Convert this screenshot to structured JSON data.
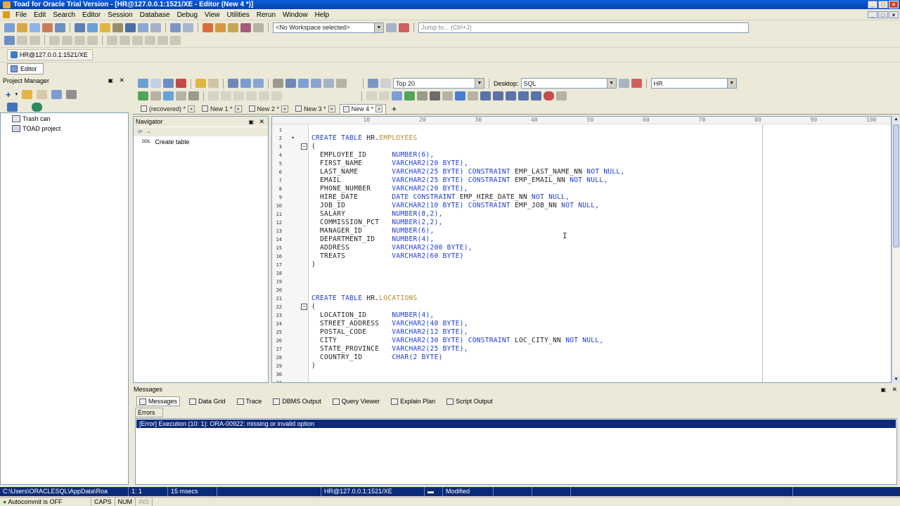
{
  "window": {
    "title": "Toad for Oracle Trial Version - [HR@127.0.0.1:1521/XE - Editor (New 4 *)]"
  },
  "menu": [
    "File",
    "Edit",
    "Search",
    "Editor",
    "Session",
    "Database",
    "Debug",
    "View",
    "Utilities",
    "Rerun",
    "Window",
    "Help"
  ],
  "toolbar": {
    "workspace": "<No Workspace selected>",
    "jump_to": "Jump to... (Ctrl+J)"
  },
  "connection": {
    "tab": "HR@127.0.0.1:1521/XE"
  },
  "editor_window": {
    "tab": "Editor"
  },
  "project_manager": {
    "title": "Project Manager",
    "items": [
      "Trash can",
      "TOAD project"
    ]
  },
  "editor_toolbar": {
    "top_n": "Top 20",
    "desktop_label": "Desktop:",
    "desktop_value": "SQL",
    "schema": "HR"
  },
  "doc_tabs": [
    {
      "label": "(recovered) *",
      "active": false
    },
    {
      "label": "New 1 *",
      "active": false
    },
    {
      "label": "New 2 *",
      "active": false
    },
    {
      "label": "New 3 *",
      "active": false
    },
    {
      "label": "New 4 *",
      "active": true
    }
  ],
  "navigator": {
    "title": "Navigator",
    "item_tag": "DDL",
    "item": "Create table"
  },
  "ruler": [
    "10",
    "20",
    "30",
    "40",
    "50",
    "60",
    "70",
    "80",
    "90",
    "100"
  ],
  "code_lines": [
    {
      "n": "1",
      "parts": []
    },
    {
      "n": "2",
      "parts": [
        {
          "c": "kw",
          "t": "CREATE TABLE "
        },
        {
          "c": "tx",
          "t": "HR."
        },
        {
          "c": "nm",
          "t": "EMPLOYEES"
        }
      ]
    },
    {
      "n": "3",
      "parts": [
        {
          "c": "tx",
          "t": "("
        }
      ]
    },
    {
      "n": "4",
      "parts": [
        {
          "c": "tx",
          "t": "  EMPLOYEE_ID      "
        },
        {
          "c": "ty",
          "t": "NUMBER(6),"
        }
      ]
    },
    {
      "n": "5",
      "parts": [
        {
          "c": "tx",
          "t": "  FIRST_NAME       "
        },
        {
          "c": "ty",
          "t": "VARCHAR2(20 BYTE),"
        }
      ]
    },
    {
      "n": "6",
      "parts": [
        {
          "c": "tx",
          "t": "  LAST_NAME        "
        },
        {
          "c": "ty",
          "t": "VARCHAR2(25 BYTE) CONSTRAINT "
        },
        {
          "c": "tx",
          "t": "EMP_LAST_NAME_NN "
        },
        {
          "c": "kw",
          "t": "NOT NULL,"
        }
      ]
    },
    {
      "n": "7",
      "parts": [
        {
          "c": "tx",
          "t": "  EMAIL            "
        },
        {
          "c": "ty",
          "t": "VARCHAR2(25 BYTE) CONSTRAINT "
        },
        {
          "c": "tx",
          "t": "EMP_EMAIL_NN "
        },
        {
          "c": "kw",
          "t": "NOT NULL,"
        }
      ]
    },
    {
      "n": "8",
      "parts": [
        {
          "c": "tx",
          "t": "  PHONE_NUMBER     "
        },
        {
          "c": "ty",
          "t": "VARCHAR2(20 BYTE),"
        }
      ]
    },
    {
      "n": "9",
      "parts": [
        {
          "c": "tx",
          "t": "  HIRE_DATE        "
        },
        {
          "c": "ty",
          "t": "DATE CONSTRAINT "
        },
        {
          "c": "tx",
          "t": "EMP_HIRE_DATE_NN "
        },
        {
          "c": "kw",
          "t": "NOT NULL,"
        }
      ]
    },
    {
      "n": "10",
      "parts": [
        {
          "c": "tx",
          "t": "  JOB_ID           "
        },
        {
          "c": "ty",
          "t": "VARCHAR2(10 BYTE) CONSTRAINT "
        },
        {
          "c": "tx",
          "t": "EMP_JOB_NN "
        },
        {
          "c": "kw",
          "t": "NOT NULL,"
        }
      ]
    },
    {
      "n": "11",
      "parts": [
        {
          "c": "tx",
          "t": "  SALARY           "
        },
        {
          "c": "ty",
          "t": "NUMBER(8,2),"
        }
      ]
    },
    {
      "n": "12",
      "parts": [
        {
          "c": "tx",
          "t": "  COMMISSION_PCT   "
        },
        {
          "c": "ty",
          "t": "NUMBER(2,2),"
        }
      ]
    },
    {
      "n": "13",
      "parts": [
        {
          "c": "tx",
          "t": "  MANAGER_ID       "
        },
        {
          "c": "ty",
          "t": "NUMBER(6),"
        }
      ]
    },
    {
      "n": "14",
      "parts": [
        {
          "c": "tx",
          "t": "  DEPARTMENT_ID    "
        },
        {
          "c": "ty",
          "t": "NUMBER(4),"
        }
      ]
    },
    {
      "n": "15",
      "parts": [
        {
          "c": "tx",
          "t": "  ADDRESS          "
        },
        {
          "c": "ty",
          "t": "VARCHAR2(200 BYTE),"
        }
      ]
    },
    {
      "n": "16",
      "parts": [
        {
          "c": "tx",
          "t": "  TREATS           "
        },
        {
          "c": "ty",
          "t": "VARCHAR2(60 BYTE)"
        }
      ]
    },
    {
      "n": "17",
      "parts": [
        {
          "c": "tx",
          "t": ")"
        }
      ]
    },
    {
      "n": "18",
      "parts": []
    },
    {
      "n": "19",
      "parts": []
    },
    {
      "n": "20",
      "parts": []
    },
    {
      "n": "21",
      "parts": [
        {
          "c": "kw",
          "t": "CREATE TABLE "
        },
        {
          "c": "tx",
          "t": "HR."
        },
        {
          "c": "nm",
          "t": "LOCATIONS"
        }
      ]
    },
    {
      "n": "22",
      "parts": [
        {
          "c": "tx",
          "t": "("
        }
      ]
    },
    {
      "n": "23",
      "parts": [
        {
          "c": "tx",
          "t": "  LOCATION_ID      "
        },
        {
          "c": "ty",
          "t": "NUMBER(4),"
        }
      ]
    },
    {
      "n": "24",
      "parts": [
        {
          "c": "tx",
          "t": "  STREET_ADDRESS   "
        },
        {
          "c": "ty",
          "t": "VARCHAR2(40 BYTE),"
        }
      ]
    },
    {
      "n": "25",
      "parts": [
        {
          "c": "tx",
          "t": "  POSTAL_CODE      "
        },
        {
          "c": "ty",
          "t": "VARCHAR2(12 BYTE),"
        }
      ]
    },
    {
      "n": "26",
      "parts": [
        {
          "c": "tx",
          "t": "  CITY             "
        },
        {
          "c": "ty",
          "t": "VARCHAR2(30 BYTE) CONSTRAINT "
        },
        {
          "c": "tx",
          "t": "LOC_CITY_NN "
        },
        {
          "c": "kw",
          "t": "NOT NULL,"
        }
      ]
    },
    {
      "n": "27",
      "parts": [
        {
          "c": "tx",
          "t": "  STATE_PROVINCE   "
        },
        {
          "c": "ty",
          "t": "VARCHAR2(25 BYTE),"
        }
      ]
    },
    {
      "n": "28",
      "parts": [
        {
          "c": "tx",
          "t": "  COUNTRY_ID       "
        },
        {
          "c": "ty",
          "t": "CHAR(2 BYTE)"
        }
      ]
    },
    {
      "n": "29",
      "parts": [
        {
          "c": "tx",
          "t": ")"
        }
      ]
    },
    {
      "n": "30",
      "parts": []
    },
    {
      "n": "31",
      "parts": []
    }
  ],
  "messages": {
    "title": "Messages",
    "tabs": [
      "Messages",
      "Data Grid",
      "Trace",
      "DBMS Output",
      "Query Viewer",
      "Explain Plan",
      "Script Output"
    ],
    "errors_label": "Errors",
    "error": "[Error] Execution (10: 1): ORA-00922: missing or invalid option"
  },
  "status": {
    "path": "C:\\Users\\ORACLESQL\\AppData\\Roa",
    "position": "1:  1",
    "time": "15 msecs",
    "connection": "HR@127.0.0.1:1521/XE",
    "modified": "Modified",
    "autocommit": "Autocommit is OFF",
    "caps": "CAPS",
    "num": "NUM",
    "ins": "INS"
  },
  "colors": {
    "keyword": "#1f3bd0",
    "object_name": "#b88a2c",
    "status_bar": "#0b2a7a",
    "title_bar": "#0a5ddb"
  }
}
